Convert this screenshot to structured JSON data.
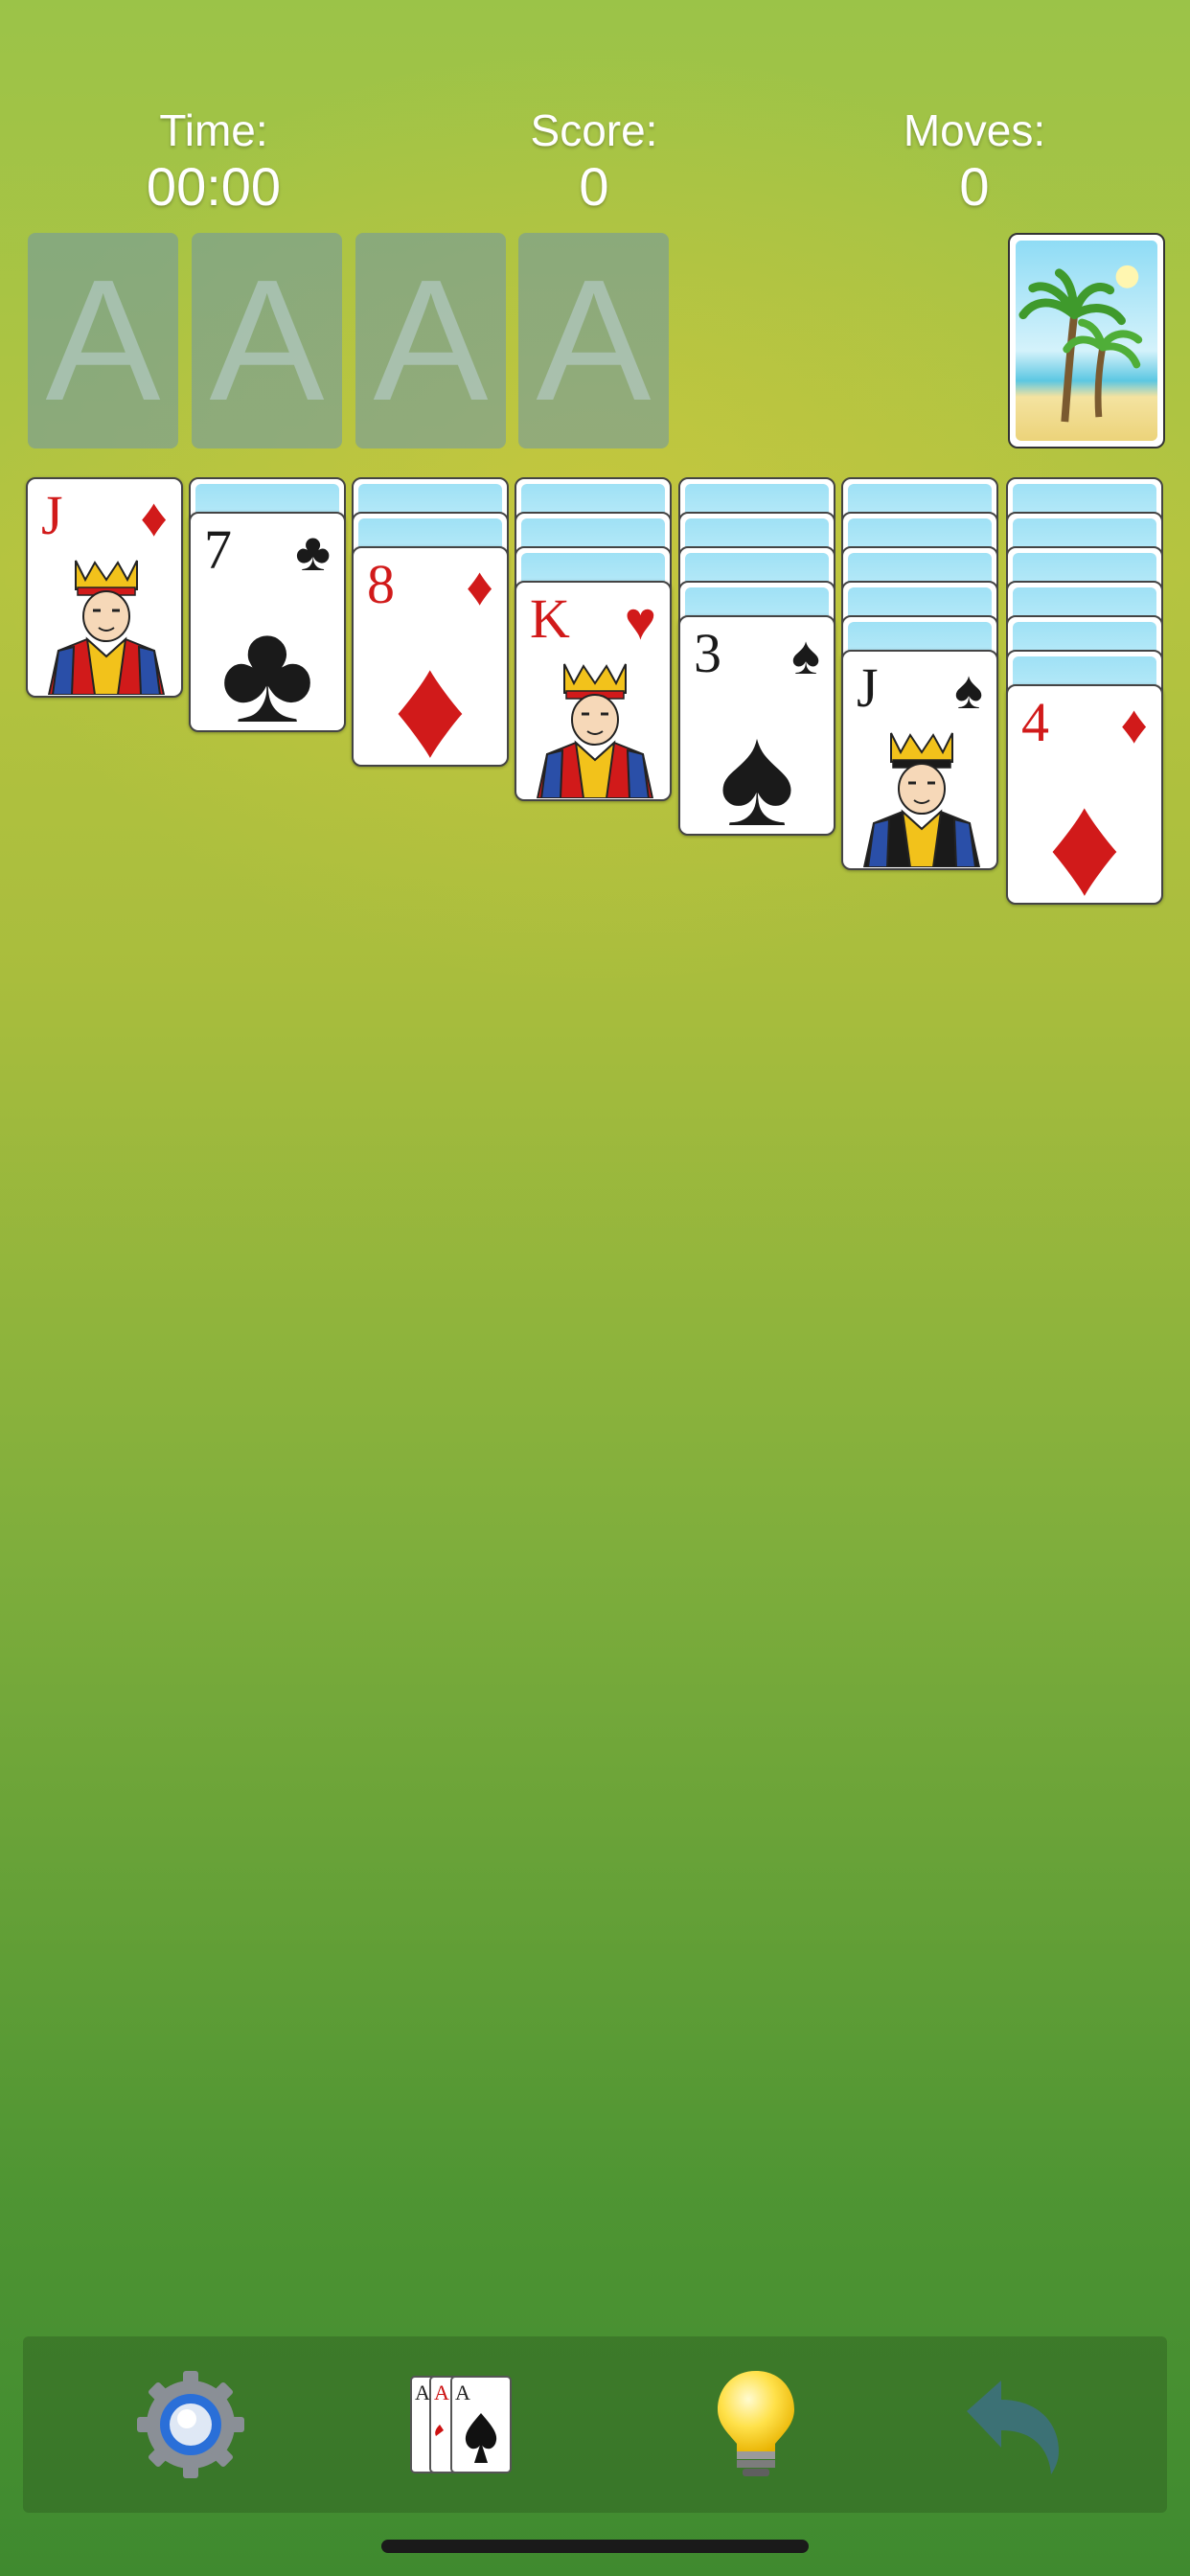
{
  "header": {
    "time_label": "Time:",
    "time_value": "00:00",
    "score_label": "Score:",
    "score_value": "0",
    "moves_label": "Moves:",
    "moves_value": "0"
  },
  "foundations": [
    {
      "placeholder": "A"
    },
    {
      "placeholder": "A"
    },
    {
      "placeholder": "A"
    },
    {
      "placeholder": "A"
    }
  ],
  "tableau": [
    {
      "face_down": 0,
      "top": {
        "rank": "J",
        "suit": "♦",
        "color": "#d11a1a"
      }
    },
    {
      "face_down": 1,
      "top": {
        "rank": "7",
        "suit": "♣",
        "color": "#1a1a1a"
      }
    },
    {
      "face_down": 2,
      "top": {
        "rank": "8",
        "suit": "♦",
        "color": "#d11a1a"
      }
    },
    {
      "face_down": 3,
      "top": {
        "rank": "K",
        "suit": "♥",
        "color": "#d11a1a"
      }
    },
    {
      "face_down": 4,
      "top": {
        "rank": "3",
        "suit": "♠",
        "color": "#1a1a1a"
      }
    },
    {
      "face_down": 5,
      "top": {
        "rank": "J",
        "suit": "♠",
        "color": "#1a1a1a"
      }
    },
    {
      "face_down": 6,
      "top": {
        "rank": "4",
        "suit": "♦",
        "color": "#d11a1a"
      }
    }
  ],
  "toolbar": {
    "items": [
      {
        "name": "settings",
        "icon": "gear-icon"
      },
      {
        "name": "new-game",
        "icon": "cards-icon"
      },
      {
        "name": "hint",
        "icon": "lightbulb-icon"
      },
      {
        "name": "undo",
        "icon": "undo-icon"
      }
    ]
  }
}
